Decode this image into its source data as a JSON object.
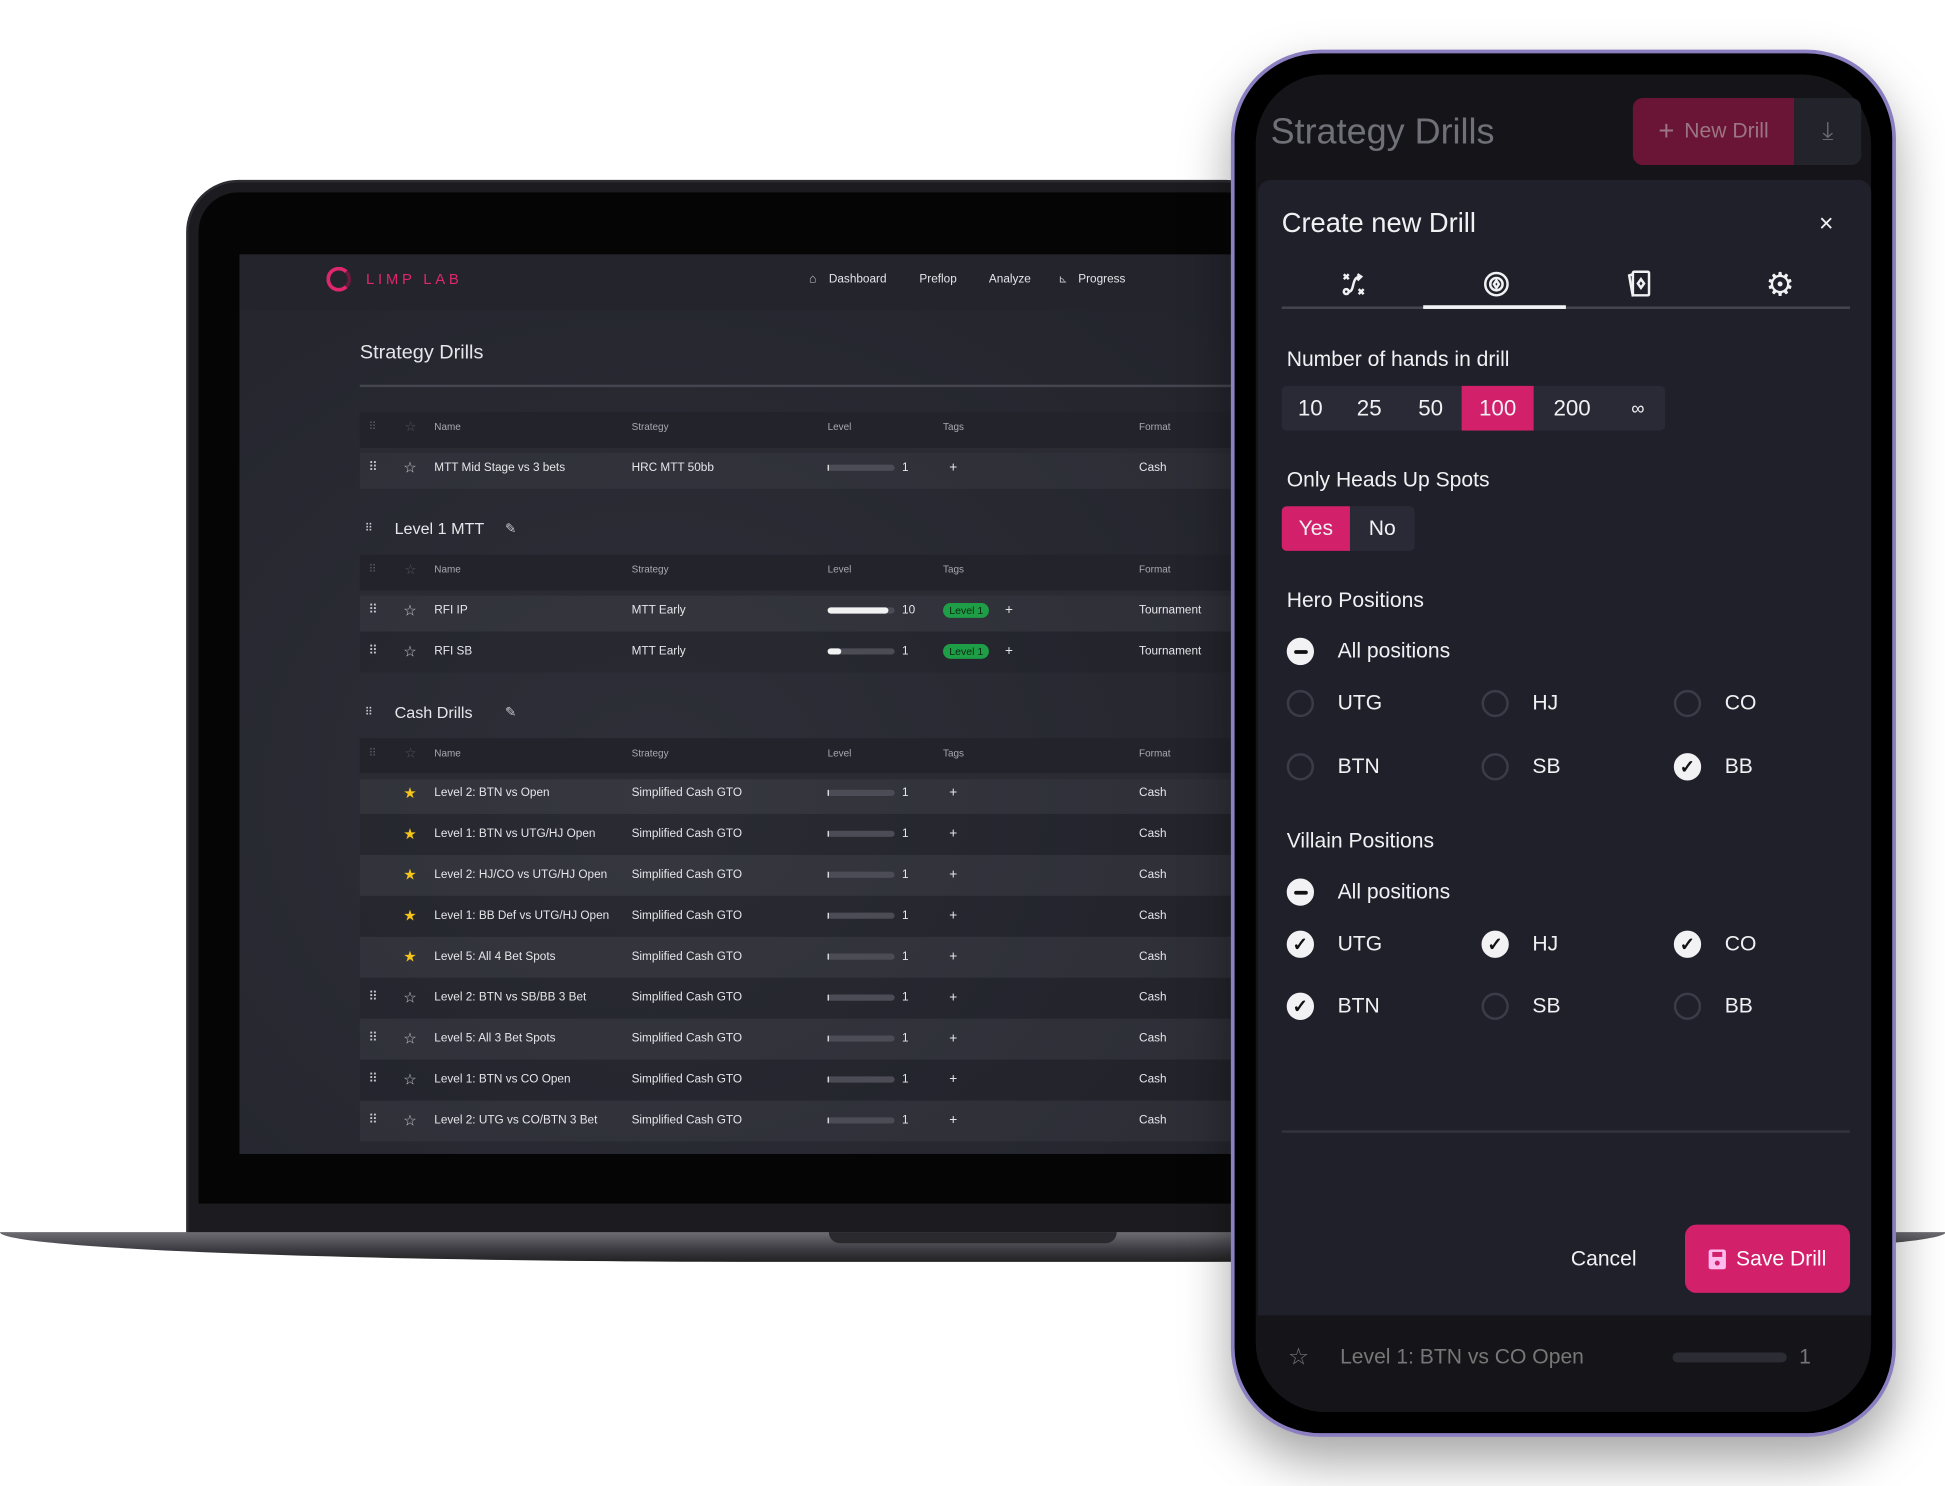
{
  "laptop": {
    "logo": "LIMP LAB",
    "nav": [
      "Dashboard",
      "Preflop",
      "Analyze",
      "Progress"
    ],
    "page_title": "Strategy Drills",
    "columns": {
      "name": "Name",
      "strategy": "Strategy",
      "level": "Level",
      "tags": "Tags",
      "format": "Format"
    },
    "groups": [
      {
        "title": "",
        "rows": [
          {
            "name": "MTT Mid Stage vs 3 bets",
            "strategy": "HRC MTT 50bb",
            "level": 1,
            "progress": 0.02,
            "tag": "",
            "format": "Cash",
            "starred": false,
            "drag": true
          }
        ]
      },
      {
        "title": "Level 1 MTT",
        "rows": [
          {
            "name": "RFI IP",
            "strategy": "MTT Early",
            "level": 10,
            "progress": 0.9,
            "tag": "Level 1",
            "format": "Tournament",
            "starred": false,
            "drag": true
          },
          {
            "name": "RFI SB",
            "strategy": "MTT Early",
            "level": 1,
            "progress": 0.2,
            "tag": "Level 1",
            "format": "Tournament",
            "starred": false,
            "drag": true
          }
        ]
      },
      {
        "title": "Cash Drills",
        "rows": [
          {
            "name": "Level 2: BTN vs Open",
            "strategy": "Simplified Cash GTO",
            "level": 1,
            "progress": 0.02,
            "tag": "",
            "format": "Cash",
            "starred": true,
            "drag": false
          },
          {
            "name": "Level 1: BTN vs UTG/HJ Open",
            "strategy": "Simplified Cash GTO",
            "level": 1,
            "progress": 0.02,
            "tag": "",
            "format": "Cash",
            "starred": true,
            "drag": false
          },
          {
            "name": "Level 2: HJ/CO vs UTG/HJ Open",
            "strategy": "Simplified Cash GTO",
            "level": 1,
            "progress": 0.02,
            "tag": "",
            "format": "Cash",
            "starred": true,
            "drag": false
          },
          {
            "name": "Level 1: BB Def vs UTG/HJ Open",
            "strategy": "Simplified Cash GTO",
            "level": 1,
            "progress": 0.02,
            "tag": "",
            "format": "Cash",
            "starred": true,
            "drag": false
          },
          {
            "name": "Level 5: All 4 Bet Spots",
            "strategy": "Simplified Cash GTO",
            "level": 1,
            "progress": 0.02,
            "tag": "",
            "format": "Cash",
            "starred": true,
            "drag": false
          },
          {
            "name": "Level 2: BTN vs SB/BB 3 Bet",
            "strategy": "Simplified Cash GTO",
            "level": 1,
            "progress": 0.02,
            "tag": "",
            "format": "Cash",
            "starred": false,
            "drag": true
          },
          {
            "name": "Level 5: All 3 Bet Spots",
            "strategy": "Simplified Cash GTO",
            "level": 1,
            "progress": 0.02,
            "tag": "",
            "format": "Cash",
            "starred": false,
            "drag": true
          },
          {
            "name": "Level 1: BTN vs CO Open",
            "strategy": "Simplified Cash GTO",
            "level": 1,
            "progress": 0.02,
            "tag": "",
            "format": "Cash",
            "starred": false,
            "drag": true
          },
          {
            "name": "Level 2: UTG vs CO/BTN 3 Bet",
            "strategy": "Simplified Cash GTO",
            "level": 1,
            "progress": 0.02,
            "tag": "",
            "format": "Cash",
            "starred": false,
            "drag": true
          }
        ]
      }
    ]
  },
  "phone": {
    "page_title": "Strategy Drills",
    "new_drill": "New Drill",
    "modal": {
      "title": "Create new Drill",
      "close": "×",
      "tabs": [
        "route-icon",
        "poker-chip-icon",
        "cards-icon",
        "gear-icon"
      ],
      "active_tab": 1,
      "hands_label": "Number of hands in drill",
      "hands_options": [
        "10",
        "25",
        "50",
        "100",
        "200",
        "∞"
      ],
      "hands_selected": "100",
      "heads_up_label": "Only Heads Up Spots",
      "heads_up_options": [
        "Yes",
        "No"
      ],
      "heads_up_selected": "Yes",
      "hero_label": "Hero Positions",
      "villain_label": "Villain Positions",
      "all_positions": "All positions",
      "positions": [
        "UTG",
        "HJ",
        "CO",
        "BTN",
        "SB",
        "BB"
      ],
      "hero_checked": [
        "BB"
      ],
      "villain_checked": [
        "UTG",
        "HJ",
        "CO",
        "BTN"
      ],
      "cancel": "Cancel",
      "save": "Save Drill"
    },
    "bottom_row": {
      "name": "Level 1: BTN vs CO Open",
      "level": "1",
      "progress": 0.02
    }
  },
  "colors": {
    "accent": "#d3206a",
    "tag_green": "#1e9e46",
    "star": "#f5c518"
  }
}
